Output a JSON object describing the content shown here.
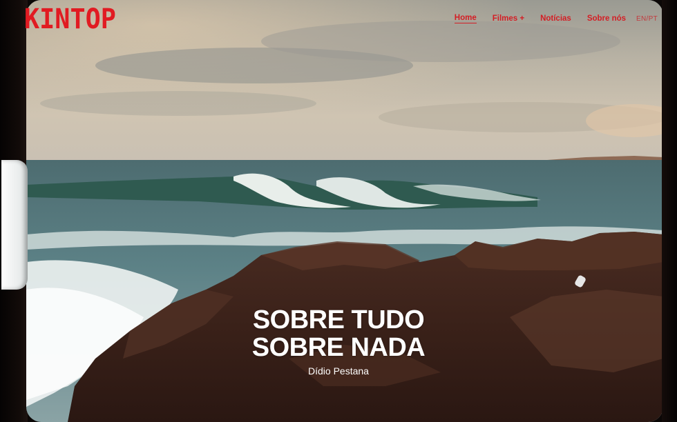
{
  "brand": {
    "logo_text": "KINTOP",
    "color": "#e11b22"
  },
  "nav": {
    "items": [
      {
        "label": "Home",
        "active": true
      },
      {
        "label": "Filmes +",
        "active": false
      },
      {
        "label": "Notícias",
        "active": false
      },
      {
        "label": "Sobre nós",
        "active": false
      }
    ],
    "language_switch": "EN/PT"
  },
  "hero": {
    "title_line1": "SOBRE TUDO",
    "title_line2": "SOBRE NADA",
    "author": "Dídio Pestana",
    "image": "film still of ocean waves crashing against dark coastal rocks under a cloudy sky"
  }
}
